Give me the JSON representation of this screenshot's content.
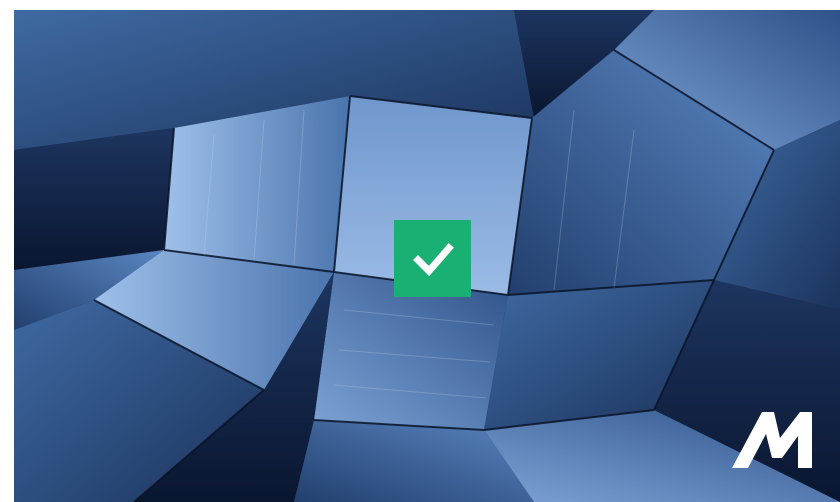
{
  "hero": {
    "image": "glass-architecture-photo",
    "sky_color": "#7aa2d6",
    "glass_dark": "#0b1a33"
  },
  "status_badge": {
    "icon": "checkmark-icon",
    "color": "#1aaf73"
  },
  "brand": {
    "icon": "m-logo-icon",
    "color": "#ffffff"
  }
}
